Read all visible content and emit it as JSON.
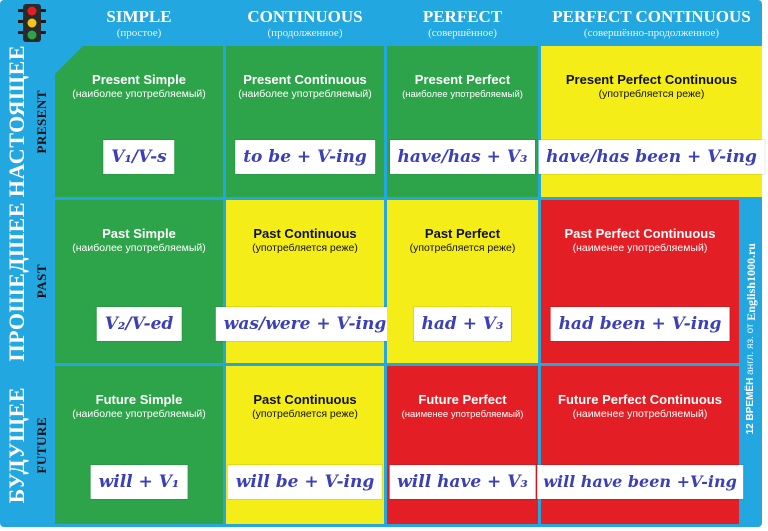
{
  "columns": [
    {
      "title": "SIMPLE",
      "subtitle": "(простое)"
    },
    {
      "title": "CONTINUOUS",
      "subtitle": "(продолженное)"
    },
    {
      "title": "PERFECT",
      "subtitle": "(совершённое)"
    },
    {
      "title": "PERFECT CONTINUOUS",
      "subtitle": "(совершённо-продолженное)"
    }
  ],
  "rows": [
    {
      "ru": "НАСТОЯЩЕЕ",
      "en": "PRESENT"
    },
    {
      "ru": "ПРОШЕДШЕЕ",
      "en": "PAST"
    },
    {
      "ru": "БУДУЩЕЕ",
      "en": "FUTURE"
    }
  ],
  "cells": [
    [
      {
        "name": "Present Simple",
        "note": "(наиболее употребляемый)",
        "formula": "V₁/V-s",
        "color": "#2ea44a"
      },
      {
        "name": "Present Continuous",
        "note": "(наиболее употребляемый)",
        "formula": "to be + V-ing",
        "color": "#2ea44a"
      },
      {
        "name": "Present Perfect",
        "note": "(наиболее употребляемый)",
        "formula": "have/has + V₃",
        "color": "#2ea44a"
      },
      {
        "name": "Present Perfect Continuous",
        "note": "(употребляется реже)",
        "formula": "have/has been + V-ing",
        "color": "#f5ed17"
      }
    ],
    [
      {
        "name": "Past Simple",
        "note": "(наиболее употребляемый)",
        "formula": "V₂/V-ed",
        "color": "#2ea44a"
      },
      {
        "name": "Past Continuous",
        "note": "(употребляется реже)",
        "formula": "was/were + V-ing",
        "color": "#f5ed17"
      },
      {
        "name": "Past Perfect",
        "note": "(употребляется реже)",
        "formula": "had + V₃",
        "color": "#f5ed17"
      },
      {
        "name": "Past Perfect Continuous",
        "note": "(наименее употребляемый)",
        "formula": "had been + V-ing",
        "color": "#e31e24"
      }
    ],
    [
      {
        "name": "Future Simple",
        "note": "(наиболее употребляемый)",
        "formula": "will + V₁",
        "color": "#2ea44a"
      },
      {
        "name": "Past Continuous",
        "note": "(употребляется реже)",
        "formula": "will be + V-ing",
        "color": "#f5ed17"
      },
      {
        "name": "Future Perfect",
        "note": "(наименее употребляемый)",
        "formula": "will have + V₃",
        "color": "#e31e24"
      },
      {
        "name": "Future Perfect Continuous",
        "note": "(наименее употребляемый)",
        "formula": "will have been +V-ing",
        "color": "#e31e24"
      }
    ]
  ],
  "sidebar": {
    "count": "12",
    "word": "ВРЕМЁН",
    "lang": "англ. яз.",
    "from": "от",
    "site": "English1000.ru"
  },
  "logo_icon": "traffic-light-icon",
  "colors": {
    "frame": "#23a7e0",
    "green": "#2ea44a",
    "yellow": "#f5ed17",
    "red": "#e31e24",
    "formula_text": "#3b3fb8"
  }
}
